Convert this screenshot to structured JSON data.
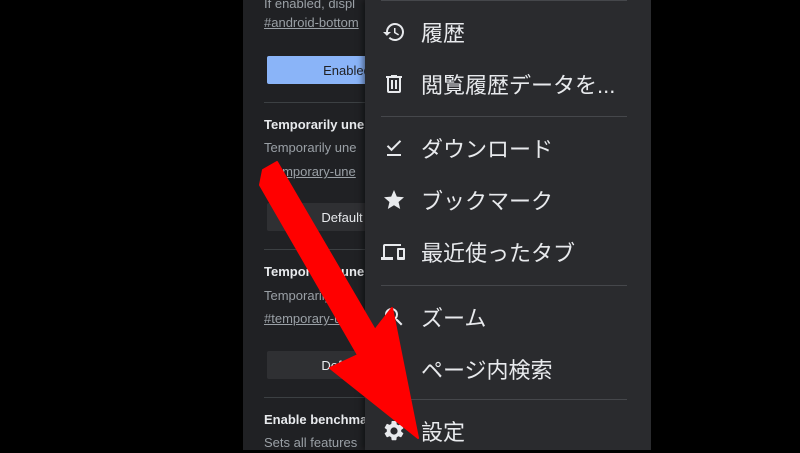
{
  "flags": {
    "top_desc": "If enabled, displ",
    "top_link": "#android-bottom",
    "top_select": "Enabled",
    "flag1_title": "Temporarily une",
    "flag1_desc": "Temporarily une",
    "flag1_link": "#temporary-une",
    "flag1_select": "Default",
    "flag2_title": "Temporarily une",
    "flag2_desc": "Temporarily",
    "flag2_link": "#temporary-u",
    "flag2_select": "Default",
    "flag3_title": "Enable benchma",
    "flag3_desc": "Sets all features"
  },
  "menu": {
    "history": "履歴",
    "clear_data": "閲覧履歴データを...",
    "downloads": "ダウンロード",
    "bookmarks": "ブックマーク",
    "recent_tabs": "最近使ったタブ",
    "zoom": "ズーム",
    "find_in_page": "ページ内検索",
    "settings": "設定"
  },
  "colors": {
    "menu_bg": "#2a2b2e",
    "page_bg": "#202124",
    "accent": "#8ab4f8",
    "arrow": "#ff0000"
  },
  "icons": {
    "history": "history-icon",
    "clear_data": "trash-icon",
    "downloads": "download-check-icon",
    "bookmarks": "star-icon",
    "recent_tabs": "devices-icon",
    "zoom": "zoom-in-icon",
    "settings": "gear-icon"
  }
}
